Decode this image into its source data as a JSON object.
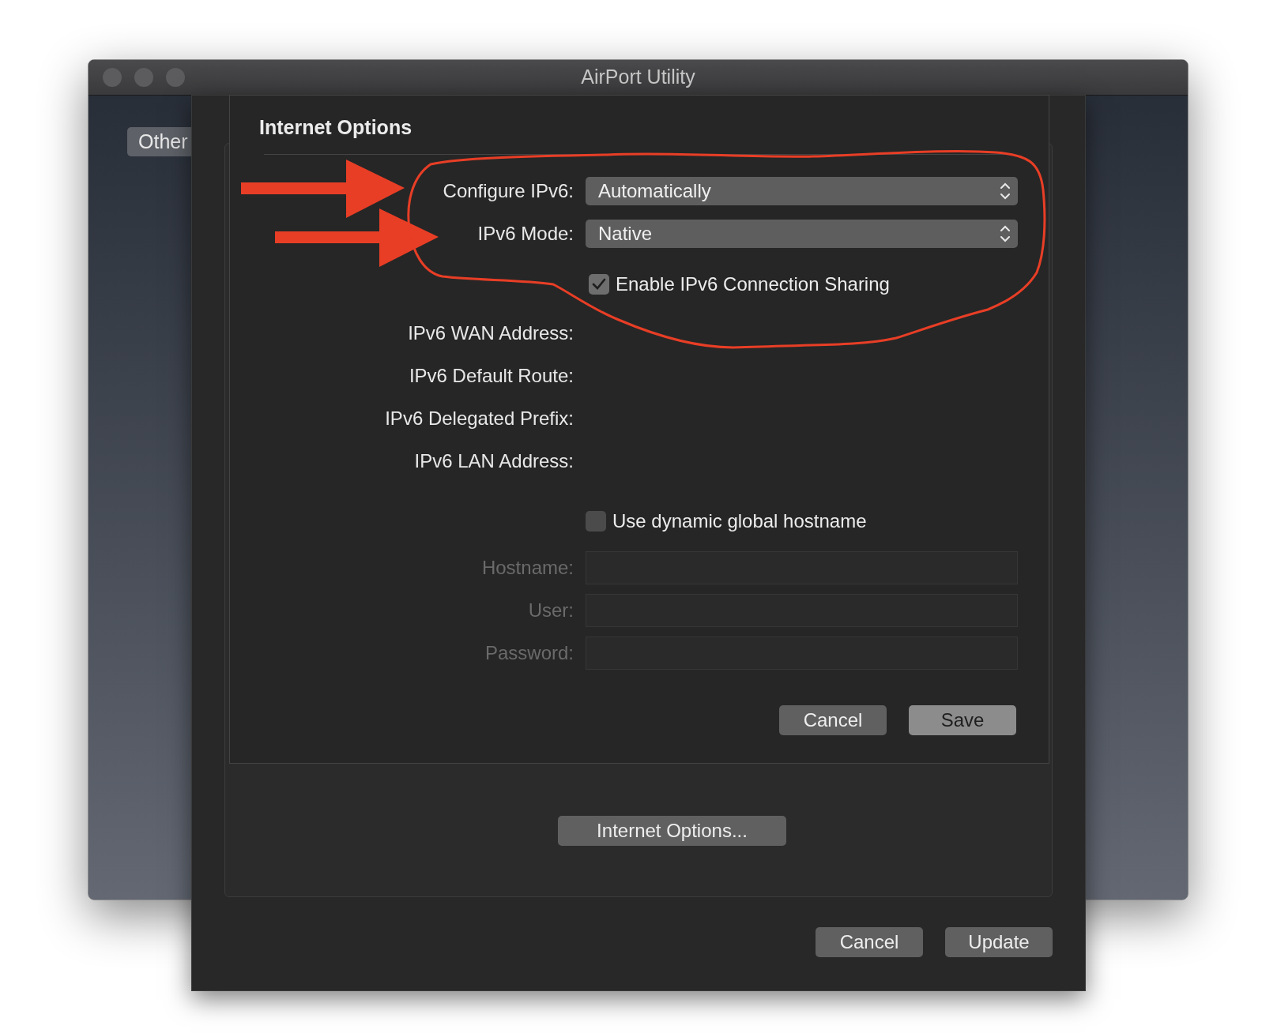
{
  "window": {
    "title": "AirPort Utility"
  },
  "background": {
    "button": "Other"
  },
  "dialog": {
    "title": "Internet Options",
    "settings": [
      {
        "kind": "popup",
        "label": "Configure IPv6:",
        "value": "Automatically"
      },
      {
        "kind": "popup",
        "label": "IPv6 Mode:",
        "value": "Native"
      },
      {
        "kind": "checkbox",
        "label": "Enable IPv6 Connection Sharing",
        "checked": true
      }
    ],
    "info": [
      "IPv6 WAN Address:",
      "IPv6 Default Route:",
      "IPv6 Delegated Prefix:",
      "IPv6 LAN Address:"
    ],
    "hostname_checkbox": {
      "label": "Use dynamic global hostname",
      "checked": false
    },
    "fields": [
      {
        "label": "Hostname:",
        "disabled": true
      },
      {
        "label": "User:",
        "disabled": true
      },
      {
        "label": "Password:",
        "disabled": true
      }
    ],
    "buttons": [
      {
        "label": "Cancel",
        "default": false
      },
      {
        "label": "Save",
        "default": true
      }
    ]
  },
  "sheet": {
    "options_button": "Internet Options...",
    "buttons": [
      {
        "label": "Cancel"
      },
      {
        "label": "Update"
      }
    ]
  }
}
